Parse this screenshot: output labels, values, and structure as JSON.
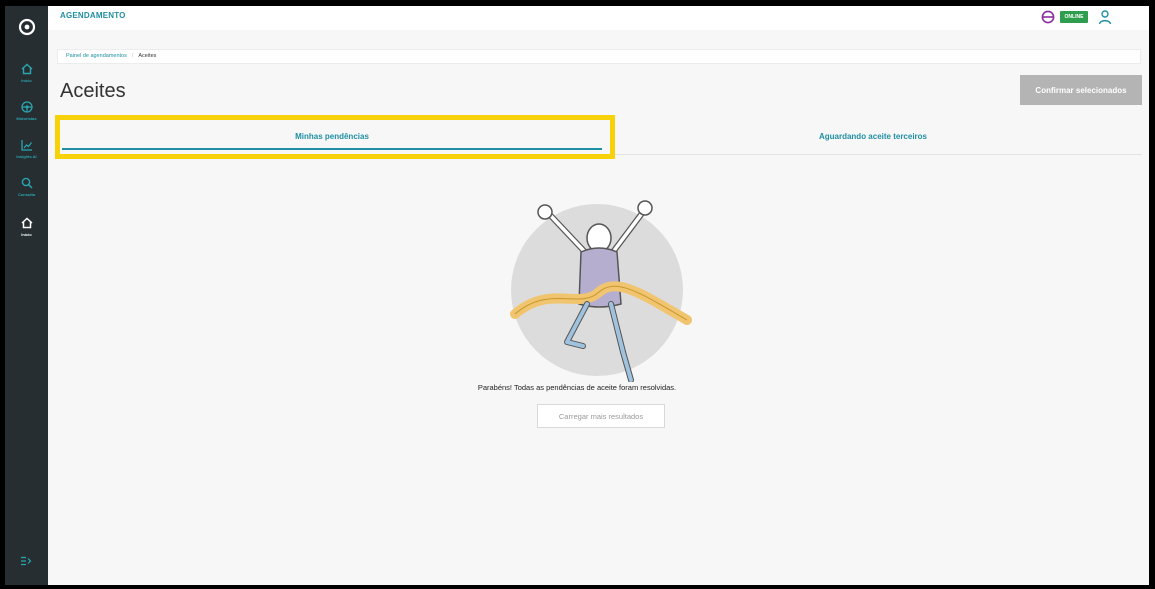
{
  "app": {
    "title": "AGENDAMENTO",
    "status_badge": "ONLINE"
  },
  "sidebar": {
    "items": [
      {
        "label": "Início",
        "icon": "home-icon"
      },
      {
        "label": "Motoristas",
        "icon": "steering-wheel-icon"
      },
      {
        "label": "Insights AI",
        "icon": "chart-icon"
      },
      {
        "label": "Consulta",
        "icon": "search-icon"
      },
      {
        "label": "Início",
        "icon": "home-icon",
        "active": true
      }
    ]
  },
  "breadcrumb": {
    "parent": "Painel de agendamentos",
    "current": "Aceites"
  },
  "page": {
    "title": "Aceites",
    "confirm_label": "Confirmar selecionados"
  },
  "tabs": [
    {
      "label": "Minhas pendências",
      "active": true
    },
    {
      "label": "Aguardando aceite terceiros",
      "active": false
    }
  ],
  "empty_state": {
    "message": "Parabéns! Todas as pendências de aceite foram resolvidas.",
    "load_more_label": "Carregar mais resultados"
  },
  "colors": {
    "accent": "#1f8fa3",
    "sidebar": "#262e31",
    "online": "#2e9e4e",
    "highlight": "#f7d20b"
  }
}
